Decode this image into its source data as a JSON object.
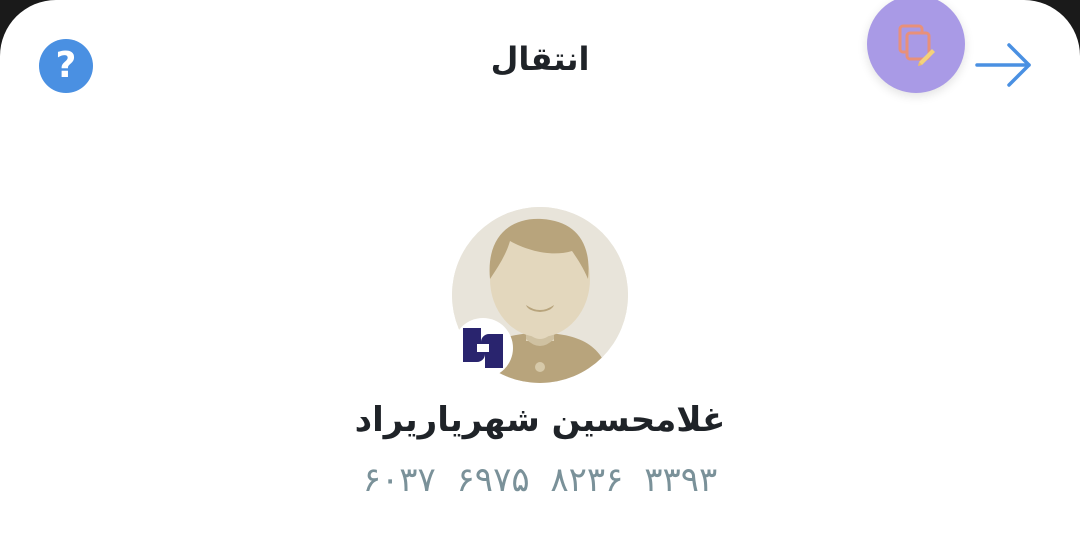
{
  "header": {
    "title": "انتقال",
    "help_label": "?",
    "back_icon": "arrow-right-icon",
    "fab_icon": "copy-edit-icon"
  },
  "recipient": {
    "name": "غلامحسین شهریاریراد",
    "card_number": "۶۰۳۷ ۶۹۷۵ ۸۲۳۶ ۳۳۹۳",
    "bank_logo": "saderat-bank-logo"
  },
  "colors": {
    "help_button": "#4a90e2",
    "fab": "#a99ae6",
    "back_arrow": "#4a90e2",
    "card_number": "#7a9199",
    "bank_logo": "#29246e"
  }
}
